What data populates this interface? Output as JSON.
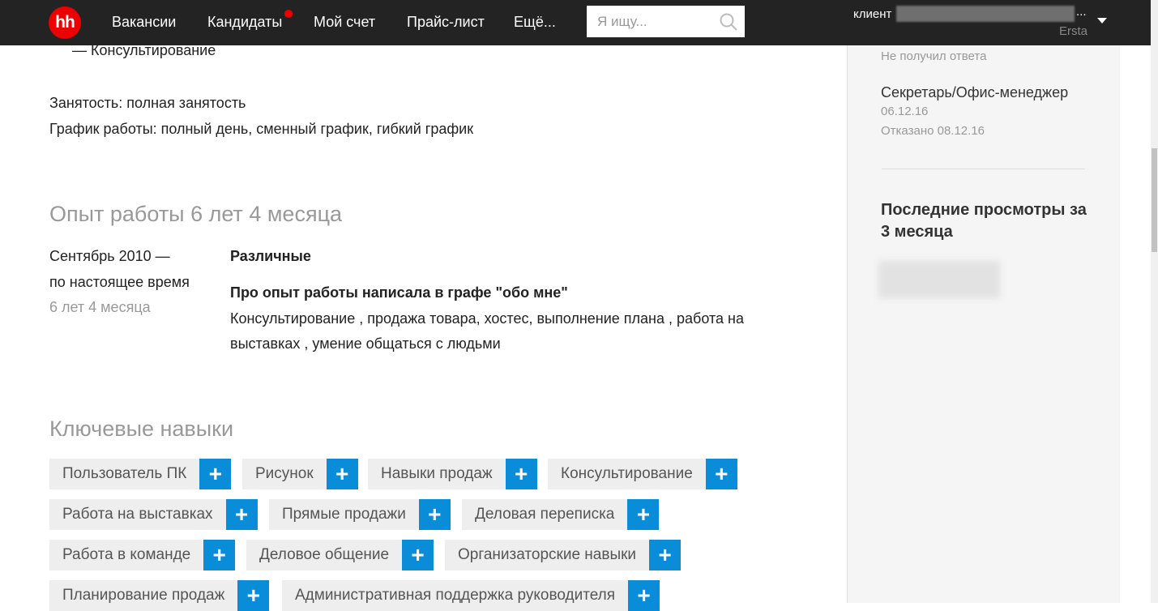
{
  "header": {
    "logo": "hh",
    "nav": [
      "Вакансии",
      "Кандидаты",
      "Мой счет",
      "Прайс-лист",
      "Ещё..."
    ],
    "search_placeholder": "Я ищу...",
    "user_label": "клиент",
    "user_ellipsis": "...",
    "user_sub": "Ersta"
  },
  "main": {
    "top_line": "— Консультирование",
    "employment": "Занятость: полная занятость",
    "schedule": "График работы: полный день, сменный график, гибкий график",
    "experience_title": "Опыт работы 6 лет 4 месяца",
    "job": {
      "period_line1": "Сентябрь 2010 —",
      "period_line2": "по настоящее время",
      "duration": "6 лет 4 месяца",
      "company": "Различные",
      "position": "Про опыт работы написала в графе \"обо мне\"",
      "desc_line1": "Консультирование , продажа товара, хостес, выполнение плана , работа на",
      "desc_line2": "выставках , умение общаться с людьми"
    },
    "skills_title": "Ключевые навыки",
    "skills": [
      "Пользователь ПК",
      "Рисунок",
      "Навыки продаж",
      "Консультирование",
      "Работа на выставках",
      "Прямые продажи",
      "Деловая переписка",
      "Работа в команде",
      "Деловое общение",
      "Организаторские навыки",
      "Планирование продаж",
      "Административная поддержка руководителя"
    ],
    "plus": "+"
  },
  "sidebar": {
    "status_top": "Не получил ответа",
    "vacancy": "Секретарь/Офис-менеджер",
    "date": "06.12.16",
    "status": "Отказано 08.12.16",
    "recent_line1": "Последние просмотры за",
    "recent_line2": "3 месяца"
  },
  "colors": {
    "header_bg": "#232323",
    "brand_red": "#e00000",
    "plus_blue": "#0a8dd8",
    "sidebar_bg": "#f5f5f5"
  }
}
